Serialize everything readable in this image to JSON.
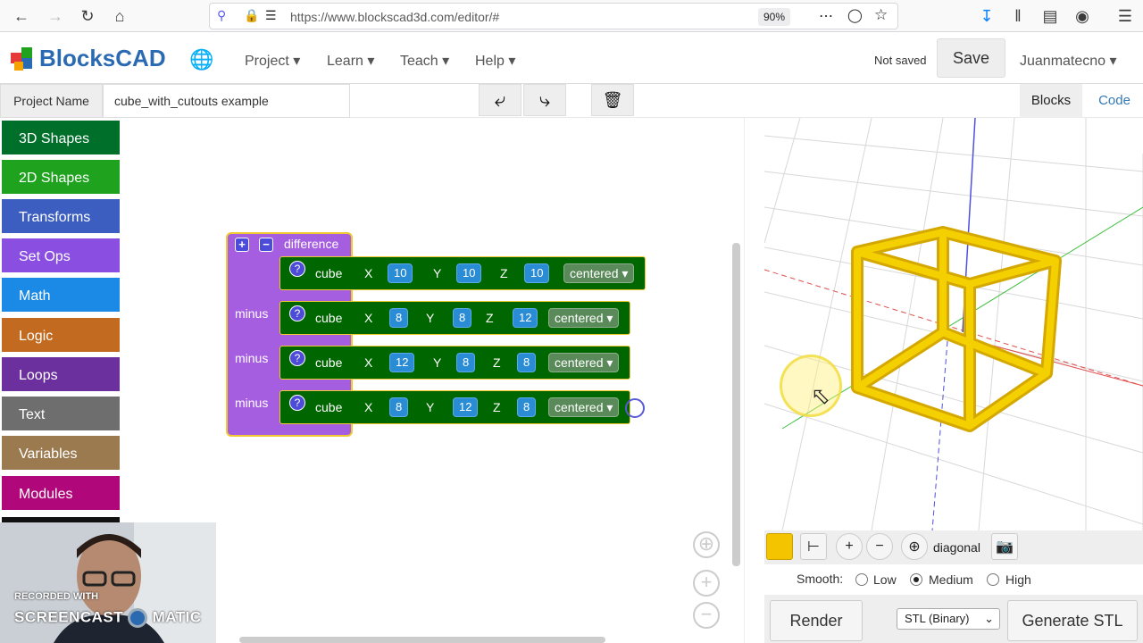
{
  "browser": {
    "url": "https://www.blockscad3d.com/editor/#",
    "zoom": "90%"
  },
  "app": {
    "logo_text": "BlocksCAD",
    "menu": [
      "Project",
      "Learn",
      "Teach",
      "Help"
    ],
    "status": "Not saved",
    "save_label": "Save",
    "user": "Juanmatecno"
  },
  "project": {
    "label": "Project Name",
    "name": "cube_with_cutouts example",
    "tabs": [
      "Blocks",
      "Code"
    ]
  },
  "toolbox": {
    "categories": [
      {
        "label": "3D Shapes",
        "color": "#006f2a"
      },
      {
        "label": "2D Shapes",
        "color": "#1fa31f"
      },
      {
        "label": "Transforms",
        "color": "#3b5ec0"
      },
      {
        "label": "Set Ops",
        "color": "#8a4fe0"
      },
      {
        "label": "Math",
        "color": "#1a8ae6"
      },
      {
        "label": "Logic",
        "color": "#c26a1f"
      },
      {
        "label": "Loops",
        "color": "#6b2f9e"
      },
      {
        "label": "Text",
        "color": "#6e6e6e"
      },
      {
        "label": "Variables",
        "color": "#9b7a4f"
      },
      {
        "label": "Modules",
        "color": "#b0087a"
      }
    ]
  },
  "blocks": {
    "difference_label": "difference",
    "minus_label": "minus",
    "cubes": [
      {
        "label": "cube",
        "x": "10",
        "y": "10",
        "z": "10",
        "mode": "centered"
      },
      {
        "label": "cube",
        "x": "8",
        "y": "8",
        "z": "12",
        "mode": "centered"
      },
      {
        "label": "cube",
        "x": "12",
        "y": "8",
        "z": "8",
        "mode": "centered"
      },
      {
        "label": "cube",
        "x": "8",
        "y": "12",
        "z": "8",
        "mode": "centered"
      }
    ],
    "axis_x": "X",
    "axis_y": "Y",
    "axis_z": "Z",
    "question": "?"
  },
  "viewer": {
    "view_label": "diagonal",
    "smooth_label": "Smooth:",
    "smooth_options": [
      "Low",
      "Medium",
      "High"
    ],
    "smooth_selected": "Medium",
    "render_label": "Render",
    "format": "STL (Binary)",
    "generate_label": "Generate STL",
    "object_color": "#f5c400"
  },
  "watermark": {
    "line1": "RECORDED WITH",
    "line2": "SCREENCAST",
    "line3": "MATIC"
  }
}
